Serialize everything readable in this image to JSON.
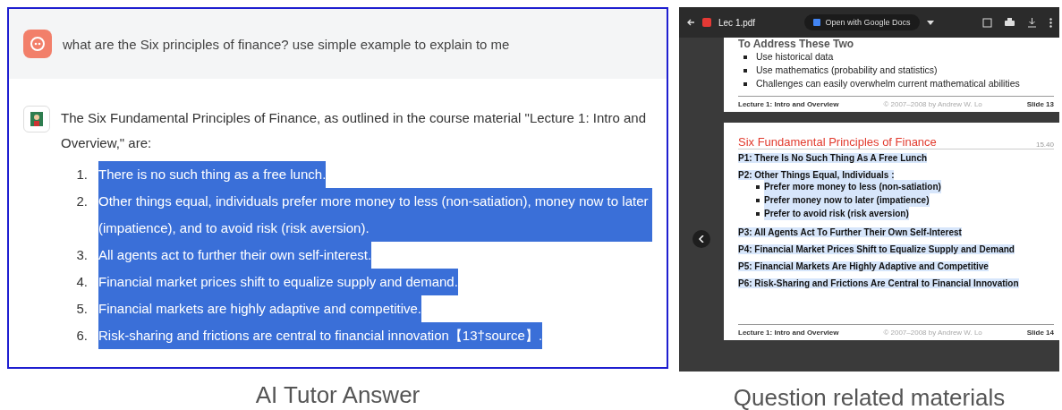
{
  "tutor_panel": {
    "question": "what are the Six principles of finance? use simple example to explain to me",
    "answer_intro": "The Six Fundamental Principles of Finance, as outlined in the course material \"Lecture 1: Intro and Overview,\" are:",
    "answer_items": [
      {
        "number": "1.",
        "text": "There is no such thing as a free lunch.",
        "highlighted": true
      },
      {
        "number": "2.",
        "text": "Other things equal, individuals prefer more money to less (non-satiation), money now to later (impatience), and to avoid risk (risk aversion).",
        "highlighted": true
      },
      {
        "number": "3.",
        "text": "All agents act to further their own self-interest.",
        "highlighted": true
      },
      {
        "number": "4.",
        "text": "Financial market prices shift to equalize supply and demand.",
        "highlighted": true
      },
      {
        "number": "5.",
        "text": "Financial markets are highly adaptive and competitive.",
        "highlighted": true
      },
      {
        "number": "6.",
        "text": "Risk-sharing and frictions are central to financial innovation【13†source】.",
        "highlighted": true
      }
    ],
    "caption": "AI Tutor Answer"
  },
  "pdf_viewer": {
    "file_name": "Lec 1.pdf",
    "open_with": "Open with Google Docs",
    "slide_13": {
      "heading": "To Address These Two",
      "bullets": [
        "Use historical data",
        "Use mathematics (probability and statistics)",
        "Challenges can easily overwhelm current mathematical abilities"
      ],
      "footer_left": "Lecture 1: Intro and Overview",
      "footer_center": "© 2007–2008 by Andrew W. Lo",
      "footer_right": "Slide 13"
    },
    "slide_14": {
      "title": "Six Fundamental Principles of Finance",
      "course": "15.40",
      "principles": [
        {
          "label": "P1:",
          "text": "There Is No Such Thing As A Free Lunch",
          "highlighted": true
        },
        {
          "label": "P2:",
          "text": "Other Things Equal, Individuals :",
          "highlighted": true,
          "bullets": [
            "Prefer more money to less (non-satiation)",
            "Prefer money now to later (impatience)",
            "Prefer to avoid risk (risk aversion)"
          ]
        },
        {
          "label": "P3:",
          "text": "All Agents Act To Further Their Own Self-Interest",
          "highlighted": true
        },
        {
          "label": "P4:",
          "text": "Financial Market Prices Shift to Equalize Supply and Demand",
          "highlighted": true
        },
        {
          "label": "P5:",
          "text": "Financial Markets Are Highly Adaptive and Competitive",
          "highlighted": true
        },
        {
          "label": "P6:",
          "text": "Risk-Sharing and Frictions Are Central to Financial Innovation",
          "highlighted": true
        }
      ],
      "footer_left": "Lecture 1: Intro and Overview",
      "footer_center": "© 2007–2008 by Andrew W. Lo",
      "footer_right": "Slide 14"
    },
    "caption": "Question related materials"
  }
}
